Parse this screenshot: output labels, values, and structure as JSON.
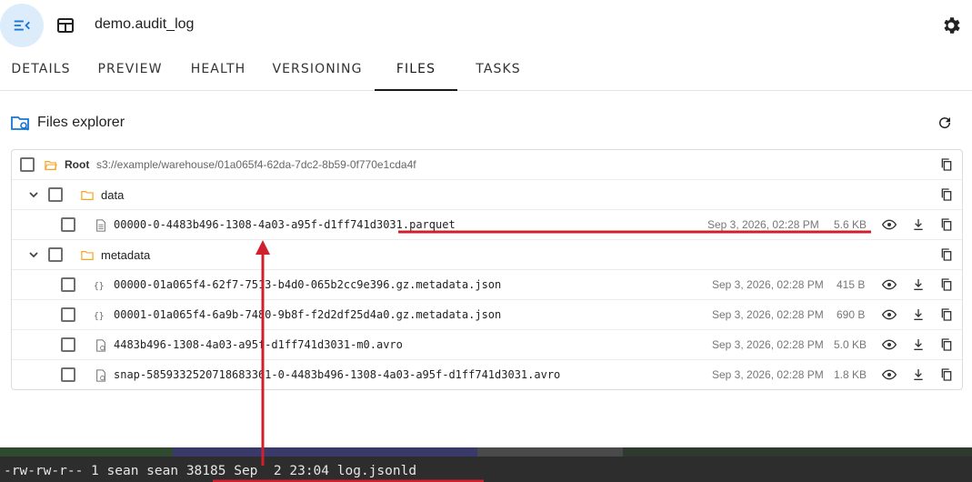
{
  "header": {
    "menu_icon": "menu-collapse-icon",
    "table_icon": "table-icon",
    "table_name": "demo.audit_log",
    "settings_icon": "gear-icon"
  },
  "tabs": [
    {
      "label": "DETAILS",
      "active": false
    },
    {
      "label": "PREVIEW",
      "active": false
    },
    {
      "label": "HEALTH",
      "active": false
    },
    {
      "label": "VERSIONING",
      "active": false
    },
    {
      "label": "FILES",
      "active": true
    },
    {
      "label": "TASKS",
      "active": false
    }
  ],
  "explorer": {
    "title": "Files explorer",
    "title_icon": "folder-search-icon",
    "refresh_icon": "refresh-icon"
  },
  "tree": {
    "root": {
      "label": "Root",
      "path": "s3://example/warehouse/01a065f4-62da-7dc2-8b59-0f770e1cda4f"
    },
    "folders": [
      {
        "name": "data",
        "files": [
          {
            "name": "00000-0-4483b496-1308-4a03-a95f-d1ff741d3031.parquet",
            "date": "Sep 3, 2026, 02:28 PM",
            "size": "5.6 KB",
            "icon": "file-icon"
          }
        ]
      },
      {
        "name": "metadata",
        "files": [
          {
            "name": "00000-01a065f4-62f7-7513-b4d0-065b2cc9e396.gz.metadata.json",
            "date": "Sep 3, 2026, 02:28 PM",
            "size": "415 B",
            "icon": "json-icon"
          },
          {
            "name": "00001-01a065f4-6a9b-7480-9b8f-f2d2df25d4a0.gz.metadata.json",
            "date": "Sep 3, 2026, 02:28 PM",
            "size": "690 B",
            "icon": "json-icon"
          },
          {
            "name": "4483b496-1308-4a03-a95f-d1ff741d3031-m0.avro",
            "date": "Sep 3, 2026, 02:28 PM",
            "size": "5.0 KB",
            "icon": "avro-file-icon"
          },
          {
            "name": "snap-5859332520718683361-0-4483b496-1308-4a03-a95f-d1ff741d3031.avro",
            "date": "Sep 3, 2026, 02:28 PM",
            "size": "1.8 KB",
            "icon": "avro-file-icon"
          }
        ]
      }
    ]
  },
  "terminal": {
    "perms": "-rw-rw-r--",
    "links": "1",
    "owner": "sean",
    "group": "sean",
    "size": "38185",
    "month": "Sep",
    "day": "2",
    "time": "23:04",
    "filename": "log.jsonld"
  },
  "colors": {
    "accent": "#1976d2",
    "menu_bg": "#dcecfb",
    "folder": "#f5a623",
    "annotation": "#d0202e",
    "terminal_bg": "#2d2d2d"
  }
}
